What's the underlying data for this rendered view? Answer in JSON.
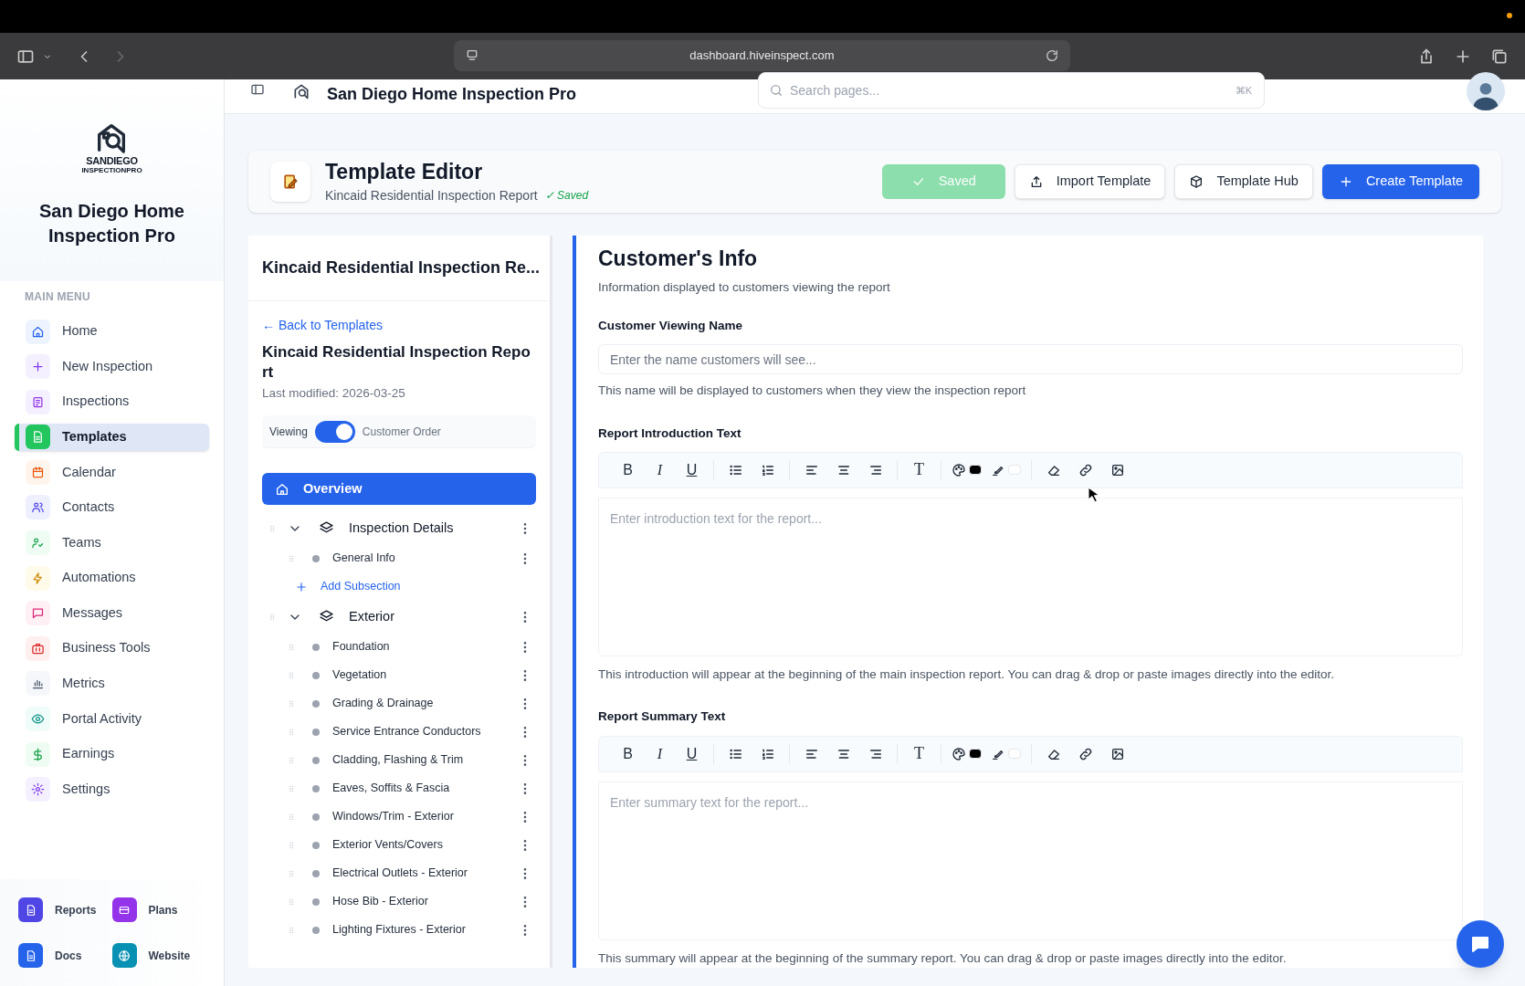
{
  "browser": {
    "url": "dashboard.hiveinspect.com"
  },
  "app_header": {
    "title": "San Diego Home Inspection Pro",
    "search": {
      "placeholder": "Search pages...",
      "shortcut": "⌘K"
    }
  },
  "sidebar": {
    "brand": {
      "logo_line_1": "SANDIEGO",
      "logo_line_2": "INSPECTIONPRO",
      "name": "San Diego Home Inspection Pro"
    },
    "section_label": "MAIN MENU",
    "items": [
      {
        "label": "Home",
        "selected": false
      },
      {
        "label": "New Inspection",
        "selected": false
      },
      {
        "label": "Inspections",
        "selected": false
      },
      {
        "label": "Templates",
        "selected": true
      },
      {
        "label": "Calendar",
        "selected": false
      },
      {
        "label": "Contacts",
        "selected": false
      },
      {
        "label": "Teams",
        "selected": false
      },
      {
        "label": "Automations",
        "selected": false
      },
      {
        "label": "Messages",
        "selected": false
      },
      {
        "label": "Business Tools",
        "selected": false
      },
      {
        "label": "Metrics",
        "selected": false
      },
      {
        "label": "Portal Activity",
        "selected": false
      },
      {
        "label": "Earnings",
        "selected": false
      },
      {
        "label": "Settings",
        "selected": false
      }
    ],
    "shortcuts": [
      {
        "label": "Reports"
      },
      {
        "label": "Plans"
      },
      {
        "label": "Docs"
      },
      {
        "label": "Website"
      }
    ]
  },
  "editor_header": {
    "title": "Template Editor",
    "subtitle": "Kincaid Residential Inspection Report",
    "saved_note": "✓ Saved",
    "buttons": [
      {
        "kind": "saved",
        "label": "Saved",
        "disabled": true
      },
      {
        "kind": "import",
        "label": "Import Template",
        "disabled": false
      },
      {
        "kind": "hub",
        "label": "Template Hub",
        "disabled": false
      },
      {
        "kind": "create",
        "label": "Create Template",
        "disabled": false
      }
    ]
  },
  "outline": {
    "heading": "Kincaid Residential Inspection Re...",
    "back_link": "← Back to Templates",
    "template_name": "Kincaid Residential Inspection Repo rt",
    "last_modified": "Last modified: 2026-03-25",
    "view_toggle": {
      "left_label": "Viewing",
      "right_label": "Customer Order",
      "on": true
    },
    "overview": {
      "label": "Overview",
      "selected": true
    },
    "sections": [
      {
        "label": "Inspection Details",
        "expanded": true,
        "children": [
          {
            "label": "General Info"
          }
        ],
        "add_label": "Add Subsection"
      },
      {
        "label": "Exterior",
        "expanded": true,
        "children": [
          {
            "label": "Foundation"
          },
          {
            "label": "Vegetation"
          },
          {
            "label": "Grading & Drainage"
          },
          {
            "label": "Service Entrance Conductors"
          },
          {
            "label": "Cladding, Flashing & Trim"
          },
          {
            "label": "Eaves, Soffits & Fascia"
          },
          {
            "label": "Windows/Trim - Exterior"
          },
          {
            "label": "Exterior Vents/Covers"
          },
          {
            "label": "Electrical Outlets - Exterior"
          },
          {
            "label": "Hose Bib - Exterior"
          },
          {
            "label": "Lighting Fixtures - Exterior"
          }
        ]
      }
    ]
  },
  "content": {
    "title": "Customer's Info",
    "subtitle": "Information displayed to customers viewing the report",
    "name_field": {
      "label": "Customer Viewing Name",
      "placeholder": "Enter the name customers will see...",
      "help": "This name will be displayed to customers when they view the inspection report"
    },
    "editors": [
      {
        "label": "Report Introduction Text",
        "placeholder": "Enter introduction text for the report...",
        "help": "This introduction will appear at the beginning of the main inspection report. You can drag & drop or paste images directly into the editor.",
        "toolbar": [
          {
            "buttons": [
              {
                "kind": "bold",
                "label": "B"
              },
              {
                "kind": "italic",
                "label": "I"
              },
              {
                "kind": "underline",
                "label": "U"
              }
            ]
          },
          {
            "buttons": [
              {
                "kind": "bullets"
              },
              {
                "kind": "numbers"
              }
            ]
          },
          {
            "buttons": [
              {
                "kind": "align-left"
              },
              {
                "kind": "align-center"
              },
              {
                "kind": "align-right"
              }
            ]
          },
          {
            "buttons": [
              {
                "kind": "font-size",
                "label": "T"
              }
            ]
          },
          {
            "buttons": [
              {
                "kind": "text-color",
                "color": "#000000"
              },
              {
                "kind": "highlight",
                "color": "#ffffff"
              }
            ]
          },
          {
            "buttons": [
              {
                "kind": "eraser"
              },
              {
                "kind": "link"
              },
              {
                "kind": "image"
              }
            ]
          }
        ]
      },
      {
        "label": "Report Summary Text",
        "placeholder": "Enter summary text for the report...",
        "help": "This summary will appear at the beginning of the summary report. You can drag & drop or paste images directly into the editor.",
        "toolbar": [
          {
            "buttons": [
              {
                "kind": "bold",
                "label": "B"
              },
              {
                "kind": "italic",
                "label": "I"
              },
              {
                "kind": "underline",
                "label": "U"
              }
            ]
          },
          {
            "buttons": [
              {
                "kind": "bullets"
              },
              {
                "kind": "numbers"
              }
            ]
          },
          {
            "buttons": [
              {
                "kind": "align-left"
              },
              {
                "kind": "align-center"
              },
              {
                "kind": "align-right"
              }
            ]
          },
          {
            "buttons": [
              {
                "kind": "font-size",
                "label": "T"
              }
            ]
          },
          {
            "buttons": [
              {
                "kind": "text-color",
                "color": "#000000"
              },
              {
                "kind": "highlight",
                "color": "#ffffff"
              }
            ]
          },
          {
            "buttons": [
              {
                "kind": "eraser"
              },
              {
                "kind": "link"
              },
              {
                "kind": "image"
              }
            ]
          }
        ]
      }
    ]
  }
}
